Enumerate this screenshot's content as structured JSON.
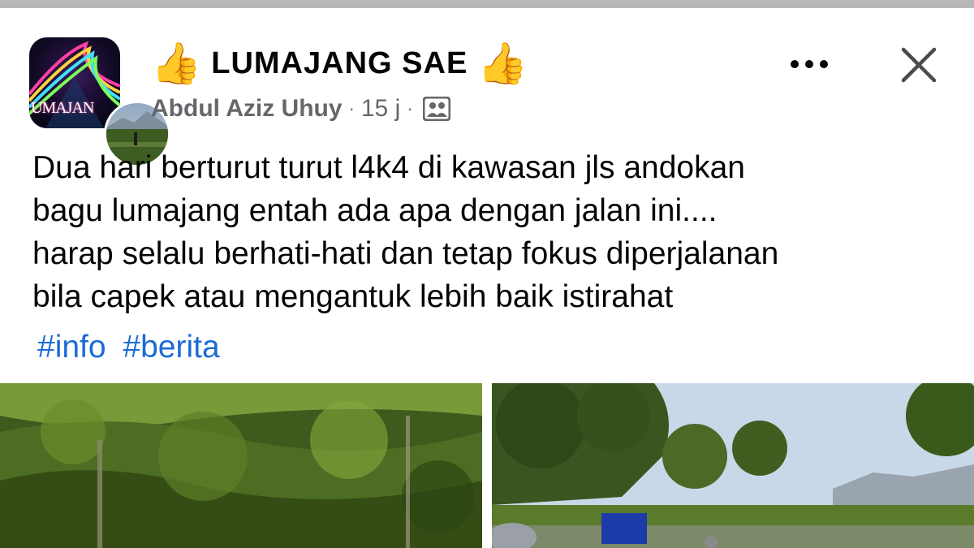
{
  "group": {
    "name": "LUMAJANG SAE",
    "name_emoji": "👍",
    "avatar_text": "UMAJAN"
  },
  "post": {
    "author": "Abdul Aziz Uhuy",
    "separator": "·",
    "time": "15 j",
    "audience_icon": "group-members-icon",
    "lines": [
      "Dua hari berturut turut l4k4 di kawasan jls andokan",
      "bagu lumajang entah ada apa dengan jalan ini....",
      "harap selalu berhati-hati dan tetap fokus diperjalanan",
      "bila capek atau mengantuk lebih baik istirahat"
    ],
    "hashtags": [
      "#info",
      "#berita"
    ]
  },
  "actions": {
    "more_icon": "more-horizontal-icon",
    "close_icon": "close-icon"
  },
  "colors": {
    "secondary_text": "#65676b",
    "hashtag": "#1b6bd6",
    "divider": "#b8b8b8"
  }
}
